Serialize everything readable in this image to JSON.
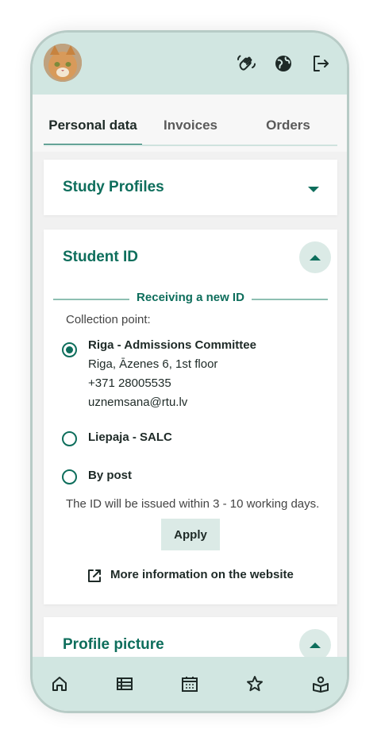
{
  "tabs": [
    "Personal data",
    "Invoices",
    "Orders"
  ],
  "cards": {
    "study_profiles": {
      "title": "Study Profiles"
    },
    "student_id": {
      "title": "Student ID",
      "section_heading": "Receiving a new ID",
      "collection_label": "Collection point:",
      "options": [
        {
          "title": "Riga - Admissions Committee",
          "lines": [
            "Riga, Āzenes 6, 1st floor",
            "+371 28005535",
            "uznemsana@rtu.lv"
          ],
          "selected": true
        },
        {
          "title": "Liepaja - SALC",
          "lines": [],
          "selected": false
        },
        {
          "title": "By post",
          "lines": [],
          "selected": false
        }
      ],
      "note": "The ID will be issued within 3 - 10 working days.",
      "apply_label": "Apply",
      "more_info_label": "More information on the website"
    },
    "profile_picture": {
      "title": "Profile picture"
    }
  },
  "icons": {
    "top": [
      "wave-hand-icon",
      "globe-icon",
      "logout-icon"
    ],
    "nav": [
      "home-icon",
      "list-icon",
      "calendar-icon",
      "star-icon",
      "book-user-icon"
    ]
  },
  "colors": {
    "accent": "#0e6e5c",
    "header_bg": "#d1e6e1",
    "chip_bg": "#dbeae6"
  }
}
